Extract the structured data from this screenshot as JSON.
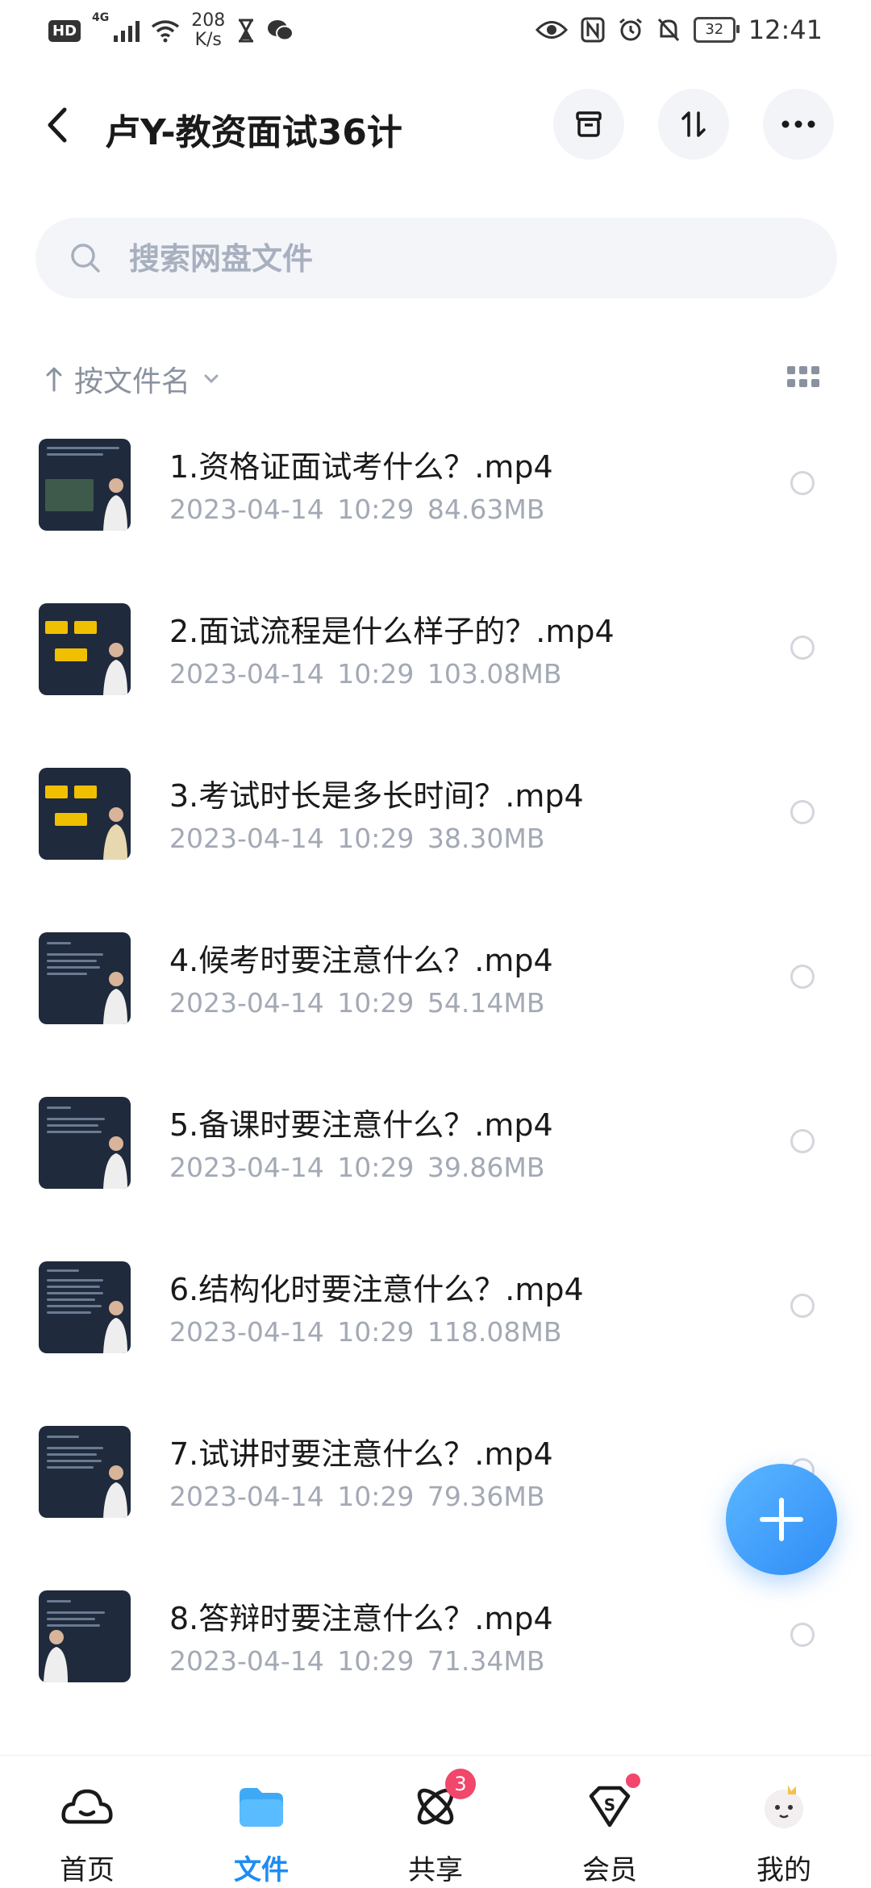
{
  "status_bar": {
    "hd": "HD",
    "network": "4G",
    "speed_value": "208",
    "speed_unit": "K/s",
    "battery": "32",
    "time": "12:41"
  },
  "header": {
    "title": "卢Y-教资面试36计"
  },
  "search": {
    "placeholder": "搜索网盘文件"
  },
  "sort": {
    "label": "按文件名"
  },
  "files": [
    {
      "name": "1.资格证面试考什么？.mp4",
      "date": "2023-04-14",
      "time": "10:29",
      "size": "84.63MB"
    },
    {
      "name": "2.面试流程是什么样子的？.mp4",
      "date": "2023-04-14",
      "time": "10:29",
      "size": "103.08MB"
    },
    {
      "name": "3.考试时长是多长时间？.mp4",
      "date": "2023-04-14",
      "time": "10:29",
      "size": "38.30MB"
    },
    {
      "name": "4.候考时要注意什么？.mp4",
      "date": "2023-04-14",
      "time": "10:29",
      "size": "54.14MB"
    },
    {
      "name": "5.备课时要注意什么？.mp4",
      "date": "2023-04-14",
      "time": "10:29",
      "size": "39.86MB"
    },
    {
      "name": "6.结构化时要注意什么？.mp4",
      "date": "2023-04-14",
      "time": "10:29",
      "size": "118.08MB"
    },
    {
      "name": "7.试讲时要注意什么？.mp4",
      "date": "2023-04-14",
      "time": "10:29",
      "size": "79.36MB"
    },
    {
      "name": "8.答辩时要注意什么？.mp4",
      "date": "2023-04-14",
      "time": "10:29",
      "size": "71.34MB"
    }
  ],
  "nav": [
    {
      "label": "首页",
      "icon": "cloud-home-icon"
    },
    {
      "label": "文件",
      "icon": "folder-icon",
      "active": true
    },
    {
      "label": "共享",
      "icon": "atom-share-icon",
      "badge": "3"
    },
    {
      "label": "会员",
      "icon": "vip-diamond-icon"
    },
    {
      "label": "我的",
      "icon": "avatar-icon"
    }
  ],
  "colors": {
    "accent": "#1f8cf3",
    "badge": "#f0476a",
    "muted": "#a3a9b5"
  }
}
